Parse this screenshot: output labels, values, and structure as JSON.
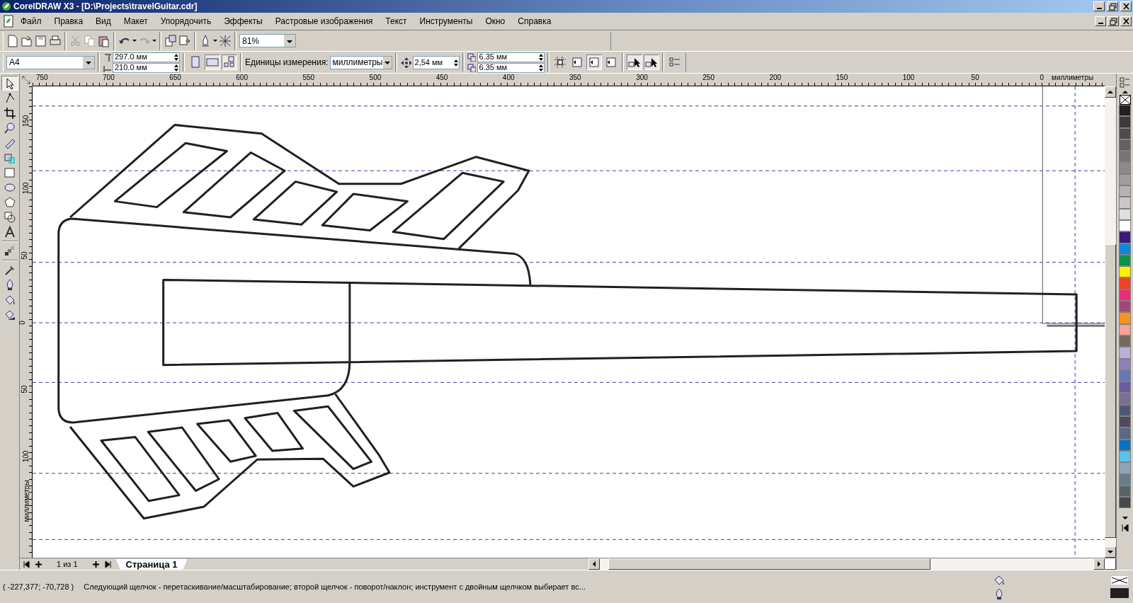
{
  "window": {
    "title": "CorelDRAW X3 - [D:\\Projects\\travelGuitar.cdr]"
  },
  "menu": [
    "Файл",
    "Правка",
    "Вид",
    "Макет",
    "Упорядочить",
    "Эффекты",
    "Растровые изображения",
    "Текст",
    "Инструменты",
    "Окно",
    "Справка"
  ],
  "standard_toolbar": {
    "zoom": "81%"
  },
  "property_bar": {
    "paper": "A4",
    "width": "297.0 мм",
    "height": "210.0 мм",
    "orientation_buttons": [
      {
        "selected": false
      },
      {
        "selected": true
      }
    ],
    "units_label": "Единицы измерения:",
    "units": "миллиметры",
    "nudge": "2,54 мм",
    "duplicate_x": "6.35 мм",
    "duplicate_y": "6.35 мм"
  },
  "toolbox": [
    {
      "selected": true
    },
    {
      "selected": false
    },
    {
      "selected": false
    },
    {
      "selected": false
    },
    {
      "selected": false
    },
    {
      "selected": false
    },
    {
      "selected": false
    },
    {
      "selected": false
    },
    {
      "selected": false
    },
    {
      "selected": false
    },
    {
      "selected": false
    },
    {
      "selected": false
    },
    {
      "selected": false
    },
    {
      "selected": false
    },
    {
      "selected": false
    },
    {
      "selected": false
    }
  ],
  "rulers": {
    "horizontal": [
      "750",
      "700",
      "650",
      "600",
      "550",
      "500",
      "450",
      "400",
      "350",
      "300",
      "250",
      "200",
      "150",
      "100",
      "50",
      "0"
    ],
    "horizontal_unit": "миллиметры",
    "vertical": [
      "150",
      "100",
      "50",
      "0",
      "50",
      "100"
    ],
    "vertical_unit": "миллиметры"
  },
  "page_navigator": {
    "counter": "1 из 1",
    "tabs": [
      {
        "label": "Страница 1",
        "selected": true
      }
    ]
  },
  "palette": [
    {
      "color": "#231f20"
    },
    {
      "color": "#3d3b3a"
    },
    {
      "color": "#4f4d4c"
    },
    {
      "color": "#636160"
    },
    {
      "color": "#777574"
    },
    {
      "color": "#8b8a89"
    },
    {
      "color": "#9f9e9d"
    },
    {
      "color": "#b4b3b2"
    },
    {
      "color": "#c9c8c7"
    },
    {
      "color": "#dfdfde"
    },
    {
      "color": "#ffffff"
    },
    {
      "color": "#3a1a7a"
    },
    {
      "color": "#0b87d9"
    },
    {
      "color": "#0b9447"
    },
    {
      "color": "#fff200"
    },
    {
      "color": "#ef4323"
    },
    {
      "color": "#ee2a7b"
    },
    {
      "color": "#a5467b"
    },
    {
      "color": "#f7941d"
    },
    {
      "color": "#f9a19a"
    },
    {
      "color": "#76695f"
    },
    {
      "color": "#b9b0d6"
    },
    {
      "color": "#8c81b9"
    },
    {
      "color": "#6a75b3"
    },
    {
      "color": "#6b5b9e"
    },
    {
      "color": "#7b6e94"
    },
    {
      "color": "#4e5877"
    },
    {
      "color": "#504a5e"
    },
    {
      "color": "#5b6984"
    },
    {
      "color": "#0a72c2"
    },
    {
      "color": "#5bc0f0"
    },
    {
      "color": "#8aa4b8"
    },
    {
      "color": "#6a7c87"
    },
    {
      "color": "#596264"
    },
    {
      "color": "#45494b"
    }
  ],
  "status_bar": {
    "coordinates": "( -227,377; -70,728 )",
    "message": "Следующий щелчок - перетаскивание/масштабирование; второй щелчок - поворот/наклон; инструмент с двойным щелчком выбирает вс..."
  }
}
